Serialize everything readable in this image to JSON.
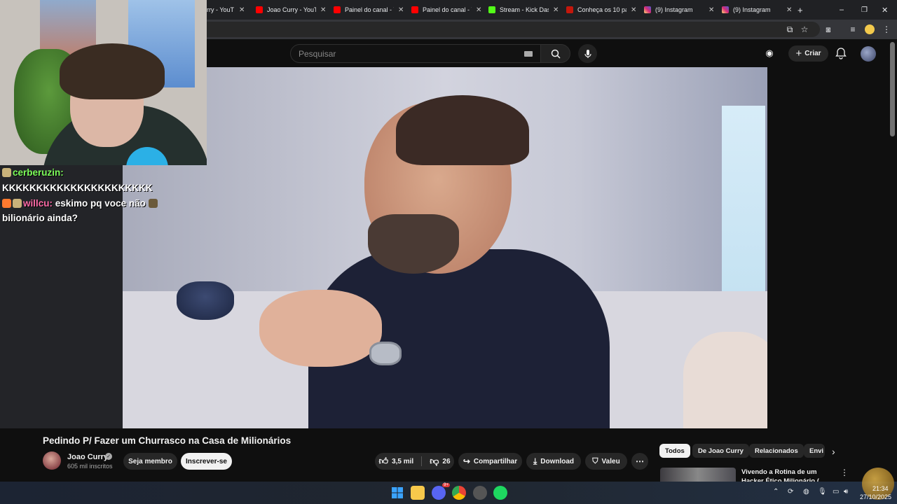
{
  "browser": {
    "tabs": [
      {
        "title": "rry - YouT",
        "favicon": "youtube-icon"
      },
      {
        "title": "Joao Curry - YouT",
        "favicon": "youtube-icon"
      },
      {
        "title": "Painel do canal - Y",
        "favicon": "youtube-icon"
      },
      {
        "title": "Painel do canal - Y",
        "favicon": "youtube-icon"
      },
      {
        "title": "Stream - Kick Das",
        "favicon": "kick-icon"
      },
      {
        "title": "Conheça os 10 pa",
        "favicon": "g1-icon"
      },
      {
        "title": "(9) Instagram",
        "favicon": "instagram-icon"
      },
      {
        "title": "(9) Instagram",
        "favicon": "instagram-icon"
      }
    ],
    "tab_close": "✕",
    "new_tab": "+"
  },
  "youtube": {
    "search_placeholder": "Pesquisar",
    "create_label": "Criar",
    "video": {
      "title": "Pedindo P/ Fazer um Churrasco na Casa de Milionários",
      "channel": "Joao Curry",
      "subscribers": "605 mil inscritos",
      "join_label": "Seja membro",
      "subscribe_label": "Inscrever-se",
      "likes": "3,5 mil",
      "dislikes": "26",
      "share_label": "Compartilhar",
      "download_label": "Download",
      "thanks_label": "Valeu"
    },
    "chips": [
      "Todos",
      "De Joao Curry",
      "Relacionados",
      "Envi"
    ],
    "recommended": {
      "title": "Vivendo a Rotina de um Hacker Ético Milionário ( Hackeou o"
    }
  },
  "overlay_chat": [
    {
      "user": "cerberuzin:",
      "message": ""
    },
    {
      "user": "",
      "message": "KKKKKKKKKKKKKKKKKKKKKK"
    },
    {
      "user": "willcu:",
      "message": "eskimo pq voce não"
    },
    {
      "user": "",
      "message": "bilionário ainda?"
    }
  ],
  "taskbar": {
    "time": "21:34",
    "date": "27/10/2025",
    "discord_badge": "9+"
  },
  "colors": {
    "youtube_red": "#ff0000",
    "kick_green": "#53fc18",
    "chat_user1": "#7dff5a",
    "chat_user2": "#ff6aa7"
  }
}
